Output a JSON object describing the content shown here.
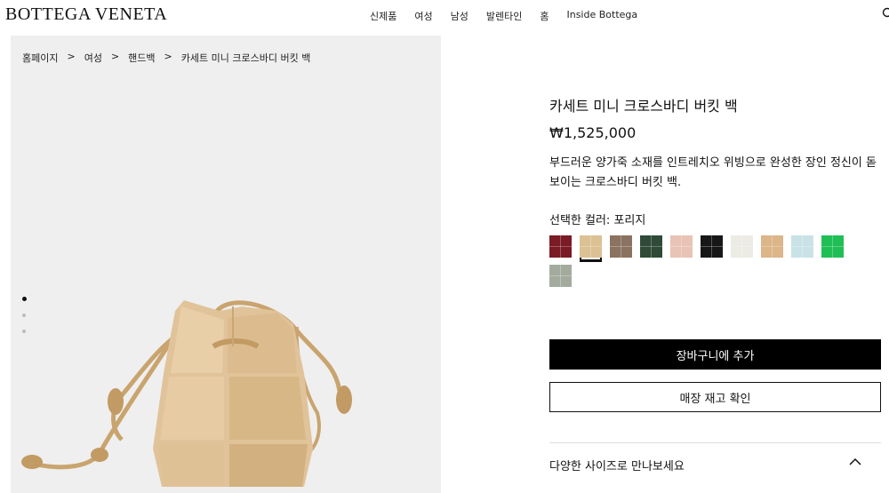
{
  "brand": "BOTTEGA VENETA",
  "nav": [
    "신제품",
    "여성",
    "남성",
    "발렌타인",
    "홈",
    "Inside Bottega"
  ],
  "breadcrumb": [
    "홈페이지",
    "여성",
    "핸드백",
    "카세트 미니 크로스바디 버킷 백"
  ],
  "breadcrumb_separator": ">",
  "gallery": {
    "slides": 3,
    "active_index": 0
  },
  "product": {
    "name": "카세트 미니 크로스바디 버킷 백",
    "price": "₩1,525,000",
    "description": "부드러운 양가죽 소재를 인트레치오 위빙으로 완성한 장인 정신이 돋보이는 크로스바디 버킷 백.",
    "color_label": "선택한 컬러: 포리지",
    "swatches": [
      {
        "color": "#7b1b25",
        "selected": false
      },
      {
        "color": "#dcc194",
        "selected": true
      },
      {
        "color": "#8a7360",
        "selected": false
      },
      {
        "color": "#2f4a37",
        "selected": false
      },
      {
        "color": "#e8c3b6",
        "selected": false
      },
      {
        "color": "#171717",
        "selected": false
      },
      {
        "color": "#ecebe4",
        "selected": false
      },
      {
        "color": "#dcb589",
        "selected": false
      },
      {
        "color": "#c9e2e6",
        "selected": false
      },
      {
        "color": "#1fbf55",
        "selected": false
      },
      {
        "color": "#a3ab9f",
        "selected": false
      }
    ]
  },
  "buttons": {
    "add_to_cart": "장바구니에 추가",
    "check_store_stock": "매장 재고 확인"
  },
  "accordion": {
    "label": "다양한 사이즈로 만나보세요",
    "expanded": true
  }
}
